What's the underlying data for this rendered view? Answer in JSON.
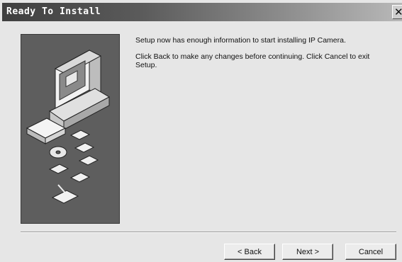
{
  "window": {
    "title": "Ready To Install",
    "close_glyph": "✕"
  },
  "message": {
    "line1": "Setup now has enough information to start installing IP Camera.",
    "line2": "Click Back to make any changes before continuing. Click Cancel to exit Setup."
  },
  "buttons": {
    "back": "< Back",
    "next": "Next >",
    "cancel": "Cancel"
  },
  "artwork": {
    "icon": "computer-with-disks-illustration"
  }
}
